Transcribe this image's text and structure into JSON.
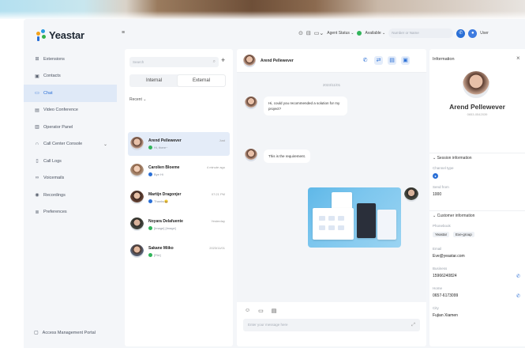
{
  "app": {
    "logo_text": "Yeastar"
  },
  "sidebar": {
    "items": [
      {
        "label": "Extensions",
        "icon": "extensions-icon"
      },
      {
        "label": "Contacts",
        "icon": "contacts-icon"
      },
      {
        "label": "Chat",
        "icon": "chat-icon",
        "active": true
      },
      {
        "label": "Video Conference",
        "icon": "video-icon"
      },
      {
        "label": "Operator Panel",
        "icon": "operator-icon"
      },
      {
        "label": "Call Center Console",
        "icon": "headset-icon",
        "has_chevron": true
      },
      {
        "label": "Call Logs",
        "icon": "calllogs-icon"
      },
      {
        "label": "Voicemails",
        "icon": "voicemail-icon"
      },
      {
        "label": "Recordings",
        "icon": "recordings-icon"
      },
      {
        "label": "Preferences",
        "icon": "preferences-icon"
      }
    ],
    "footer_label": "Access Management Portal"
  },
  "topbar": {
    "agent_status": "Agent Status",
    "availability": "Available",
    "search_placeholder": "Number or Name",
    "user_label": "User"
  },
  "conversations": {
    "search_placeholder": "Search",
    "tabs": [
      "Internal",
      "External"
    ],
    "active_tab": 1,
    "recent_label": "Recent",
    "items": [
      {
        "name": "Arend Pellewever",
        "time": "Just",
        "preview": "Hi, there~",
        "color": "#31b45b"
      },
      {
        "name": "Carolien Bloeme",
        "time": "4 minute ago",
        "preview": "Bye Hi",
        "color": "#2a6fd6"
      },
      {
        "name": "Martijn Dragonjer",
        "time": "07:21 PM",
        "preview": "Thanks😀",
        "color": "#2a6fd6"
      },
      {
        "name": "Noyara Delafuente",
        "time": "Yesterday",
        "preview": "[Image] [Image]",
        "color": "#31b45b"
      },
      {
        "name": "Sakane Miiko",
        "time": "2023/11/01",
        "preview": "[File]",
        "color": "#31b45b"
      }
    ]
  },
  "chat": {
    "contact_name": "Arend Pellewever",
    "date": "2023/11/01",
    "messages": [
      "Hi, could you recommended a solution for my project?",
      "This is the requirement."
    ],
    "composer_placeholder": "Enter your message here"
  },
  "info": {
    "title": "Information",
    "name": "Arend Pellewever",
    "subtitle": "0653-0542039",
    "session_title": "Session information",
    "channel_label": "Channel type",
    "sent_label": "Send from",
    "sent_value": "1000",
    "customer_title": "Customer information",
    "phonebook_label": "Phonebook",
    "phonebook_tags": [
      "Yeastar",
      "Exe-group"
    ],
    "email_label": "Email",
    "email_value": "Eve@yeastar.com",
    "business_label": "Business",
    "business_value": "15966240824",
    "home_label": "Home",
    "home_value": "0657-6173099",
    "city_label": "City",
    "city_value": "Fujian Xiamen"
  },
  "colors": {
    "accent": "#2a6fd6",
    "available": "#31b45b",
    "active_bg": "#dfe9f7"
  }
}
